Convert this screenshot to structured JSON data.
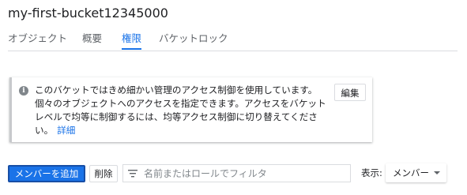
{
  "bucket": {
    "title": "my-first-bucket12345000"
  },
  "tabs": [
    {
      "label": "オブジェクト",
      "active": false
    },
    {
      "label": "概要",
      "active": false
    },
    {
      "label": "権限",
      "active": true
    },
    {
      "label": "バケットロック",
      "active": false
    }
  ],
  "notice": {
    "icon": "info-icon",
    "text": "このバケットではきめ細かい管理のアクセス制御を使用しています。個々のオブジェクトへのアクセスを指定できます。アクセスをバケットレベルで均等に制御するには、均等アクセス制御に切り替えてください。",
    "link_label": "詳細",
    "edit_label": "編集"
  },
  "toolbar": {
    "add_member_label": "メンバーを追加",
    "delete_label": "削除",
    "filter_placeholder": "名前またはロールでフィルタ",
    "filter_value": "",
    "view_label": "表示:",
    "view_value": "メンバー"
  },
  "colors": {
    "accent": "#1a73e8",
    "border": "#dadce0",
    "muted": "#5f6368"
  }
}
